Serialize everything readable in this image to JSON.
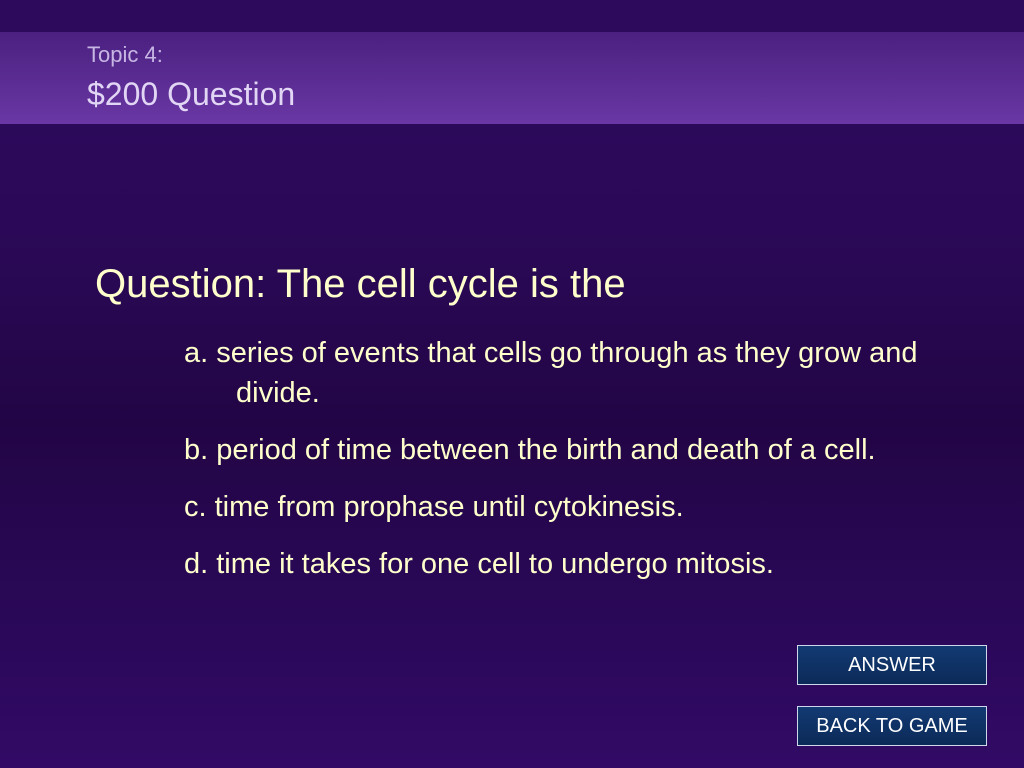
{
  "slide": {
    "topic": "Topic 4:",
    "title": "$200 Question",
    "question": "Question: The cell cycle is the",
    "choices": [
      "a. series of events that cells go through as they grow and divide.",
      "b. period of time between the birth and death of a cell.",
      "c. time from prophase until cytokinesis.",
      "d. time it takes for one cell to undergo mitosis."
    ]
  },
  "buttons": {
    "answer": "ANSWER",
    "back": "BACK TO GAME"
  },
  "colors": {
    "background": "#2b0958",
    "header_band": "#5a2c92",
    "text": "#ffffcc",
    "button_fill": "#0f3163",
    "button_border": "#cfd7ea"
  }
}
